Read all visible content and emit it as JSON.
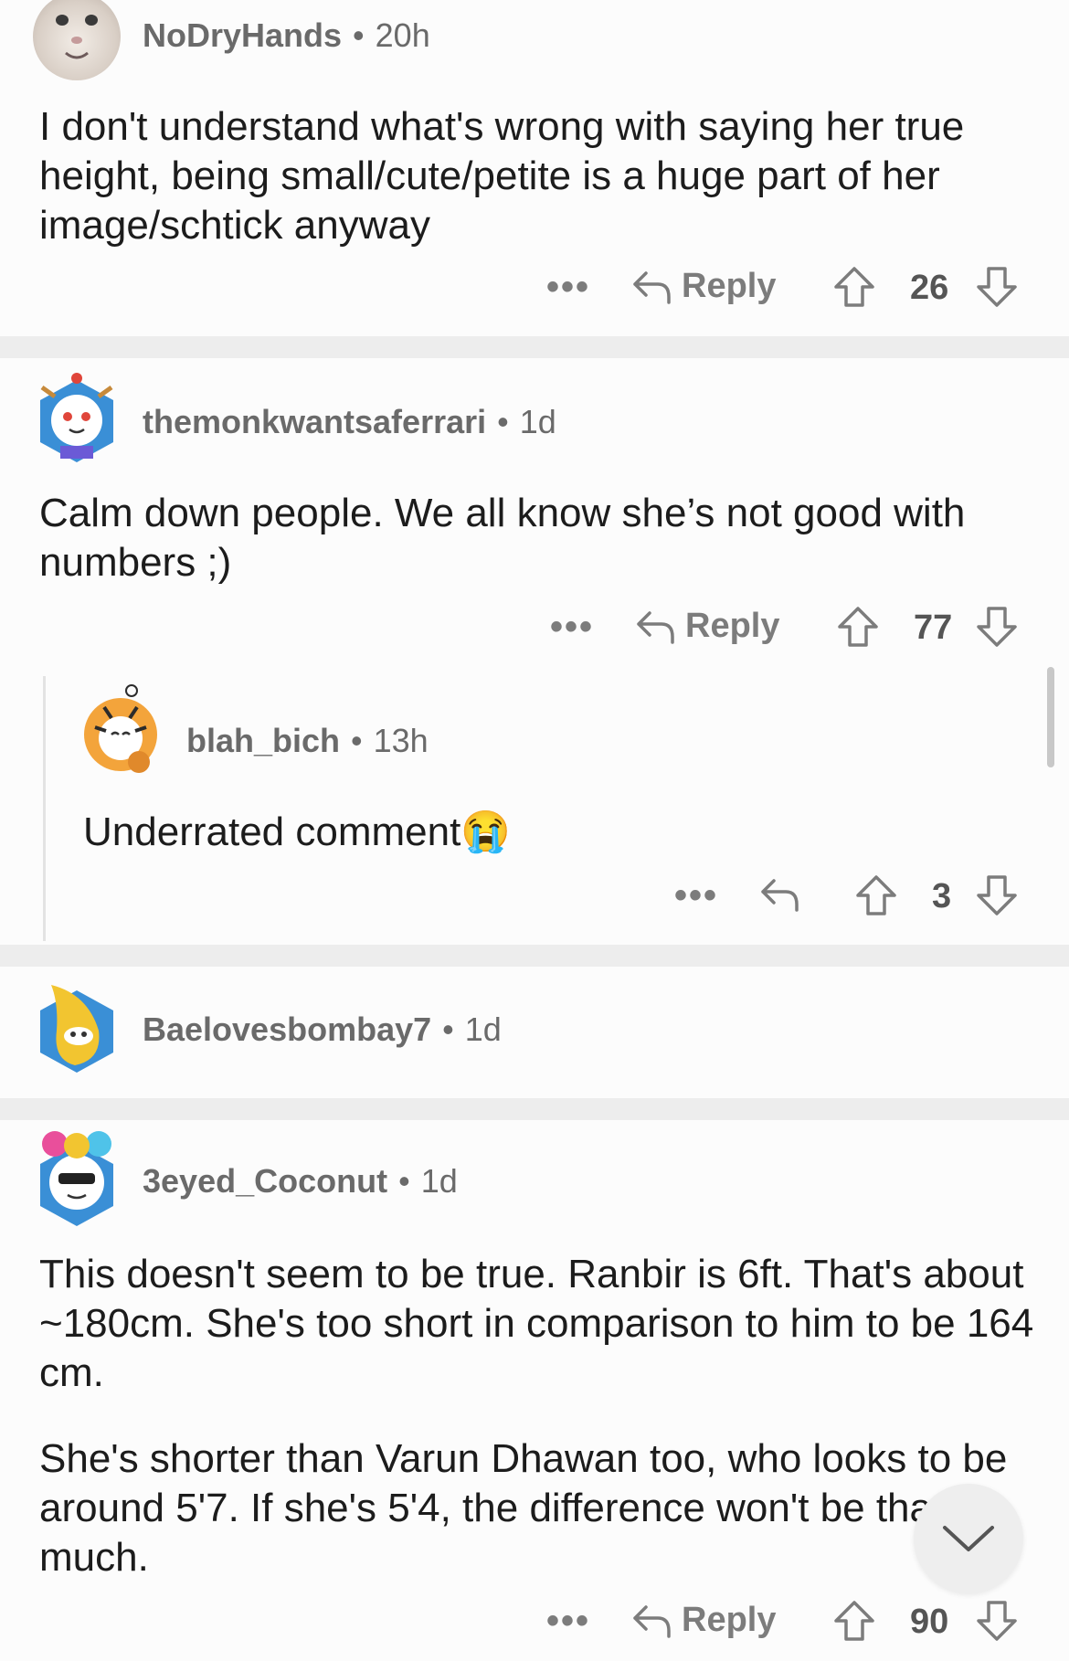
{
  "comments": [
    {
      "username": "NoDryHands",
      "time": "20h",
      "text": [
        "I don't understand what's wrong with saying her true height, being small/cute/petite is a huge part of her image/schtick anyway"
      ],
      "score": "26",
      "reply_label": "Reply"
    },
    {
      "username": "themonkwantsaferrari",
      "time": "1d",
      "text": [
        "Calm down people. We all know she’s not good with numbers ;)"
      ],
      "score": "77",
      "reply_label": "Reply"
    },
    {
      "username": "blah_bich",
      "time": "13h",
      "text": [
        "Underrated comment"
      ],
      "emoji": "😭",
      "score": "3"
    },
    {
      "username": "Baelovesbombay7",
      "time": "1d"
    },
    {
      "username": "3eyed_Coconut",
      "time": "1d",
      "text": [
        "This doesn't seem to be true. Ranbir is 6ft. That's about ~180cm. She's too short in comparison to him to be 164 cm.",
        "She's shorter than Varun Dhawan too, who looks to be around 5'7. If she's 5'4,  the difference won't be that much."
      ],
      "score": "90",
      "reply_label": "Reply"
    }
  ],
  "more_label": "•••",
  "separator": "•",
  "colors": {
    "background": "#fcfcfc",
    "separator": "#ededed",
    "meta_text": "#6a6a6a",
    "action_text": "#7c7c7c"
  },
  "icons": [
    "reply-arrow-icon",
    "upvote-arrow-icon",
    "downvote-arrow-icon",
    "chevron-down-icon"
  ]
}
